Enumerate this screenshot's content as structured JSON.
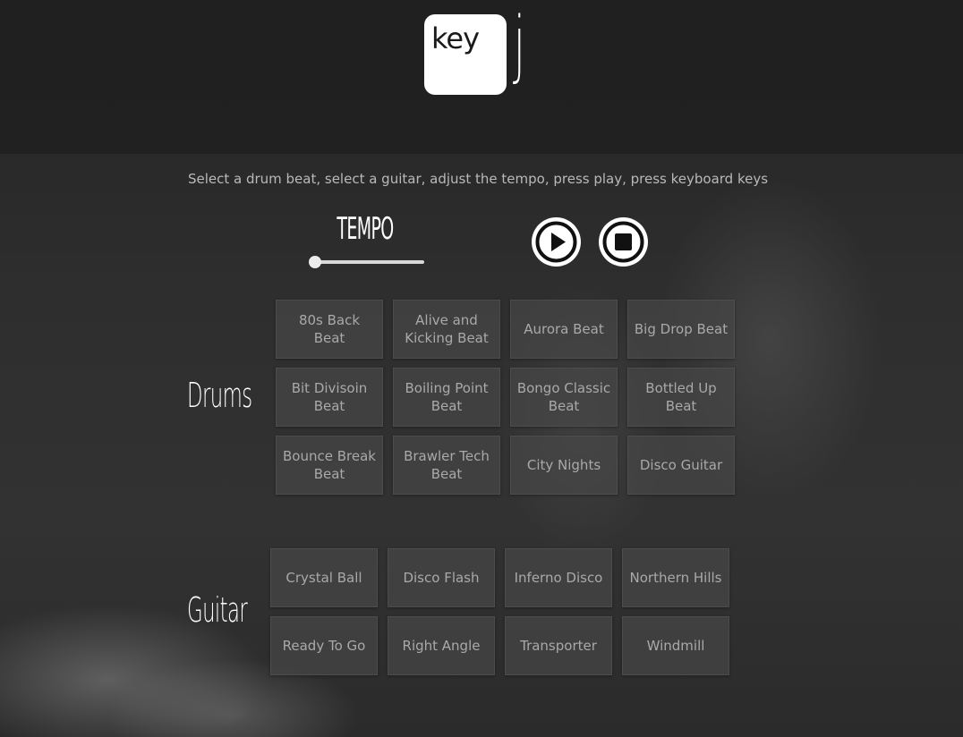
{
  "logo": {
    "key_text": "key",
    "letter": "j"
  },
  "instructions": "Select a drum beat, select a guitar, adjust the tempo, press play, press keyboard keys",
  "tempo": {
    "label": "TEMPO",
    "value_fraction": 0.0
  },
  "controls": {
    "play_icon": "play-icon",
    "stop_icon": "stop-icon"
  },
  "drums": {
    "label": "Drums",
    "beats": [
      "80s Back Beat",
      "Alive and Kicking Beat",
      "Aurora Beat",
      "Big Drop Beat",
      "Bit Divisoin Beat",
      "Boiling Point Beat",
      "Bongo Classic Beat",
      "Bottled Up Beat",
      "Bounce Break Beat",
      "Brawler Tech Beat",
      "City Nights",
      "Disco Guitar"
    ]
  },
  "guitar": {
    "label": "Guitar",
    "tracks": [
      "Crystal Ball",
      "Disco Flash",
      "Inferno Disco",
      "Northern Hills",
      "Ready To Go",
      "Right Angle",
      "Transporter",
      "Windmill"
    ]
  },
  "colors": {
    "background": "#2a2a2a",
    "tile": "#464646",
    "tile_text": "#a9a9a9",
    "accent": "#ffffff"
  }
}
